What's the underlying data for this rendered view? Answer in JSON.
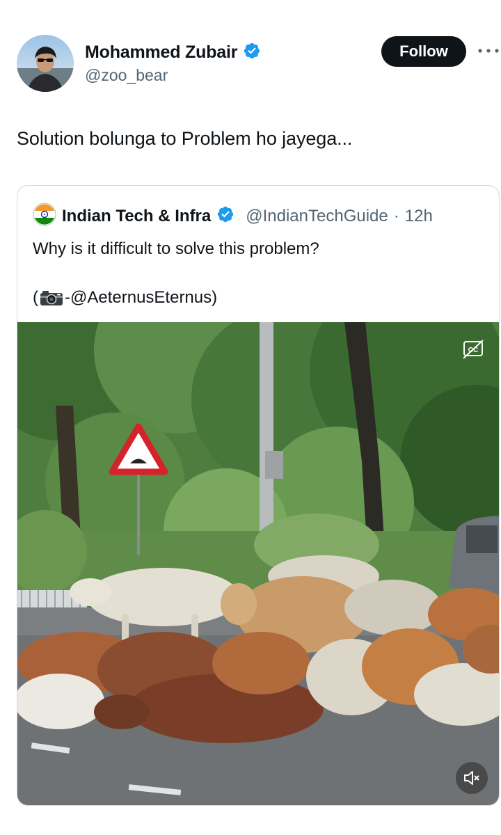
{
  "author": {
    "name": "Mohammed Zubair",
    "handle": "@zoo_bear",
    "verified": true
  },
  "follow_label": "Follow",
  "more_icon": "more-horizontal-icon",
  "tweet_text": "Solution bolunga to Problem ho jayega...",
  "quote": {
    "name": "Indian Tech & Infra",
    "handle": "@IndianTechGuide",
    "separator": "·",
    "time": "12h",
    "text_line1": "Why is it difficult to solve this problem?",
    "credit_open": "(",
    "credit_icon": "camera-icon",
    "credit_text": "-@AeternusEternus)",
    "media": {
      "type": "video",
      "subject": "herd of cattle resting on a city road",
      "controls": [
        "captions-icon",
        "mute-icon"
      ]
    }
  },
  "colors": {
    "text": "#0f1419",
    "secondary": "#536471",
    "verified": "#1d9bf0",
    "border": "#cfd9de",
    "follow_bg": "#0f1419"
  }
}
